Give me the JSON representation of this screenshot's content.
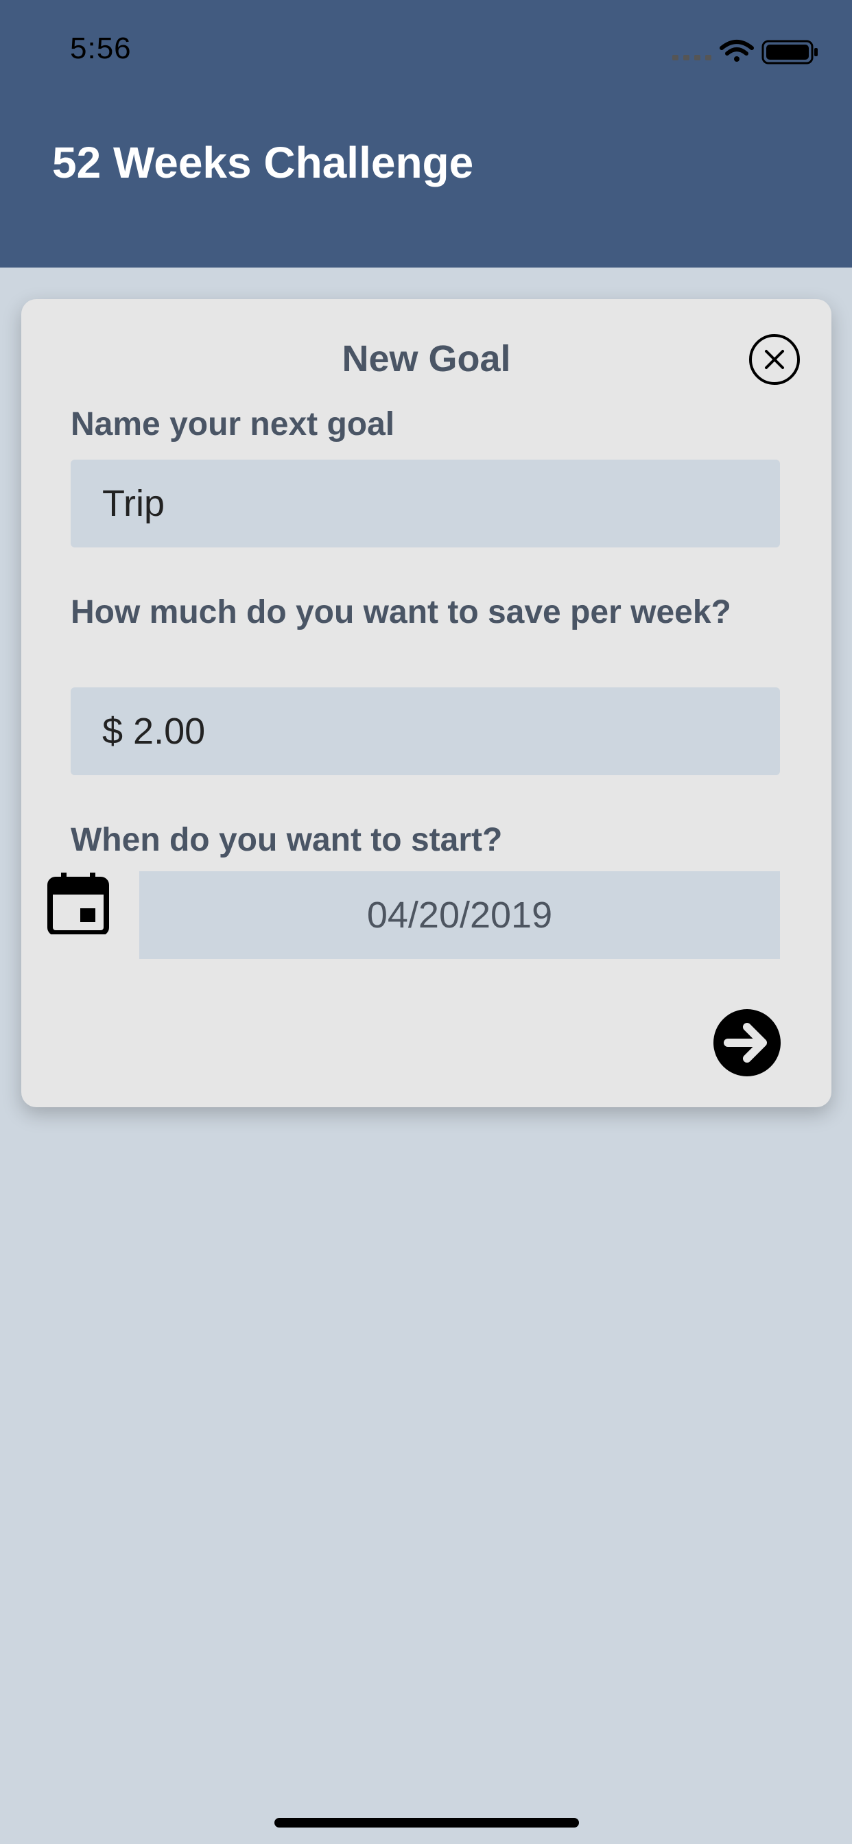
{
  "status_bar": {
    "time": "5:56"
  },
  "header": {
    "title": "52 Weeks Challenge"
  },
  "dialog": {
    "title": "New Goal",
    "close_icon": "close-circle-icon",
    "goal_name_label": "Name your next goal",
    "goal_name_value": "Trip",
    "weekly_amount_label": "How much do you want to save per week?",
    "weekly_amount_value": "$ 2.00",
    "start_date_label": "When do you want to start?",
    "start_date_value": "04/20/2019",
    "calendar_icon": "calendar-icon",
    "next_icon": "arrow-right-circle-icon"
  },
  "colors": {
    "header_bg": "#425b80",
    "page_bg": "#cdd6df",
    "card_bg": "#e6e6e6",
    "label_text": "#4a5565"
  }
}
